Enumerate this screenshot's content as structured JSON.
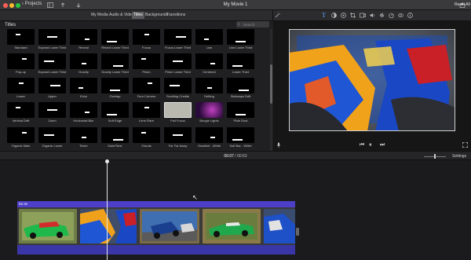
{
  "titlebar": {
    "back_label": "‹ Projects",
    "title": "My Movie 1"
  },
  "media_tabs": [
    "My Media",
    "Audio & Video",
    "Titles",
    "Backgrounds",
    "Transitions"
  ],
  "active_tab": "Titles",
  "browser": {
    "section_title": "Titles",
    "search_placeholder": "Search",
    "tiles": [
      "Standard",
      "Expand Lower Third",
      "Reveal",
      "Reveal Lower Third",
      "Focus",
      "Focus Lower Third",
      "Line",
      "Line Lower Third",
      "Pop-up",
      "Expand Lower Third",
      "Gravity",
      "Gravity Lower Third",
      "Prism",
      "Prism Lower Third",
      "Centered",
      "Lower Third",
      "Lower",
      "Upper",
      "Echo",
      "Overlap",
      "Four Corners",
      "Scrolling Credits",
      "Drifting",
      "Sideways Drift",
      "Vertical Drift",
      "Zoom",
      "Horizontal Blur",
      "Soft Edge",
      "Lens Flare",
      "Pull Focus",
      "Boogie Lights",
      "Pixie Dust",
      "Organic Main",
      "Organic Lower",
      "Ticker",
      "Date/Time",
      "Clouds",
      "Far Far Away",
      "Gradient - White",
      "Soft Bar - White"
    ]
  },
  "viewer": {
    "reset_label": "Reset All"
  },
  "timecode": {
    "current": "00:07",
    "separator": "/",
    "total": "00:53"
  },
  "settings_label": "Settings",
  "timeline": {
    "clip_duration": "52.3s"
  }
}
